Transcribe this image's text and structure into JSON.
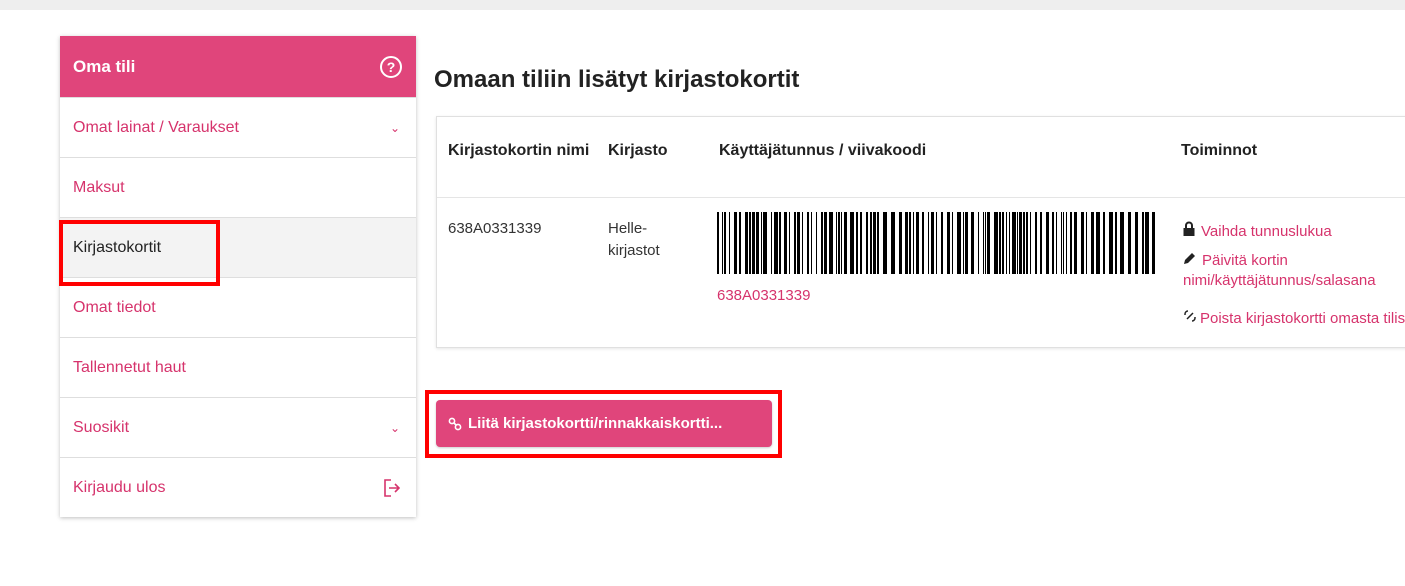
{
  "sidebar": {
    "title": "Oma tili",
    "help_icon": "question-circle-icon",
    "items": [
      {
        "label": "Omat lainat / Varaukset",
        "icon": "chevron-down-icon"
      },
      {
        "label": "Maksut"
      },
      {
        "label": "Kirjastokortit",
        "active": true
      },
      {
        "label": "Omat tiedot"
      },
      {
        "label": "Tallennetut haut"
      },
      {
        "label": "Suosikit",
        "icon": "chevron-down-icon"
      },
      {
        "label": "Kirjaudu ulos",
        "icon": "logout-icon"
      }
    ]
  },
  "main": {
    "title": "Omaan tiliin lisätyt kirjastokortit",
    "table": {
      "headers": [
        "Kirjastokortin nimi",
        "Kirjasto",
        "Käyttäjätunnus / viivakoodi",
        "Toiminnot"
      ],
      "rows": [
        {
          "card_name": "638A0331339",
          "library": "Helle-kirjastot",
          "barcode_value": "638A0331339",
          "actions": [
            {
              "label": "Vaihda tunnuslukua",
              "icon": "lock-icon"
            },
            {
              "label": "Päivitä kortin nimi/käyttäjätunnus/salasana",
              "icon": "pencil-icon"
            },
            {
              "label": "Poista kirjastokortti omasta tilistä",
              "icon": "unlink-icon"
            }
          ]
        }
      ]
    },
    "link_button": {
      "label": "Liitä kirjastokortti/rinnakkaiskortti...",
      "icon": "link-icon"
    }
  },
  "colors": {
    "accent": "#e0457b",
    "link": "#d6336c",
    "highlight": "#ff0000"
  }
}
